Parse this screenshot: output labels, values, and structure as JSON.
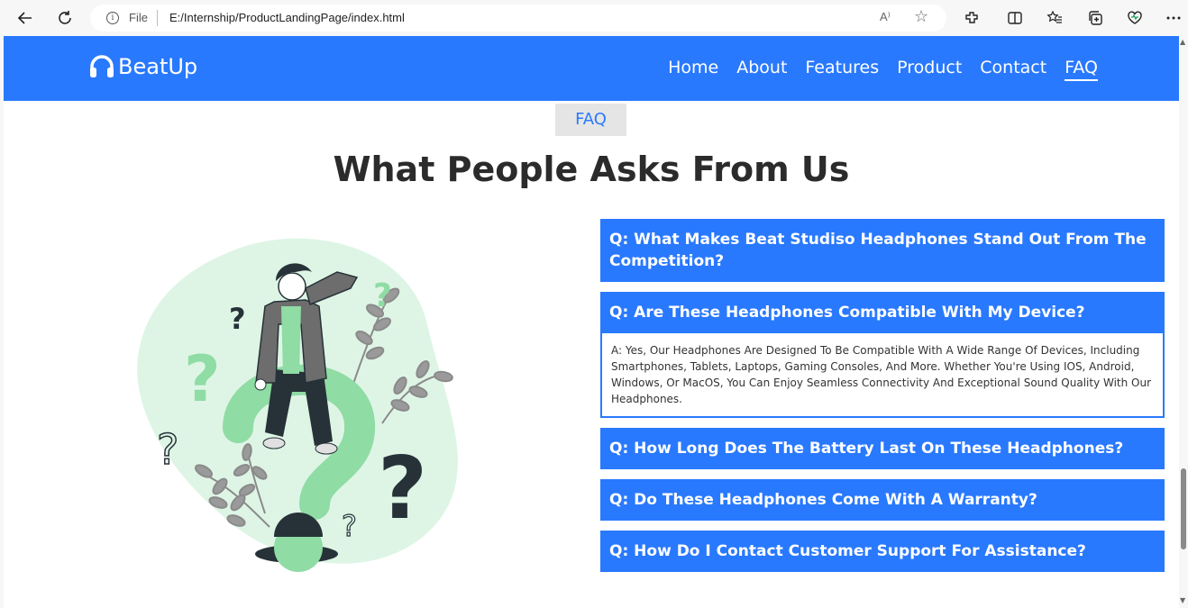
{
  "browser": {
    "file_label": "File",
    "url": "E:/Internship/ProductLandingPage/index.html",
    "read_aloud": "A⁾"
  },
  "nav": {
    "brand": "BeatUp",
    "links": [
      "Home",
      "About",
      "Features",
      "Product",
      "Contact",
      "FAQ"
    ],
    "active": "FAQ"
  },
  "faq_section": {
    "badge": "FAQ",
    "title": "What People Asks From Us",
    "items": [
      {
        "q": "Q: What Makes Beat Studiso Headphones Stand Out From The Competition?"
      },
      {
        "q": "Q: Are These Headphones Compatible With My Device?",
        "a": "A: Yes, Our Headphones Are Designed To Be Compatible With A Wide Range Of Devices, Including Smartphones, Tablets, Laptops, Gaming Consoles, And More. Whether You're Using IOS, Android, Windows, Or MacOS, You Can Enjoy Seamless Connectivity And Exceptional Sound Quality With Our Headphones."
      },
      {
        "q": "Q: How Long Does The Battery Last On These Headphones?"
      },
      {
        "q": "Q: Do These Headphones Come With A Warranty?"
      },
      {
        "q": "Q: How Do I Contact Customer Support For Assistance?"
      }
    ]
  },
  "colors": {
    "primary": "#2979ff",
    "illustration_green": "#8fdca5",
    "illustration_bg": "#def5e5",
    "dark": "#263238"
  }
}
